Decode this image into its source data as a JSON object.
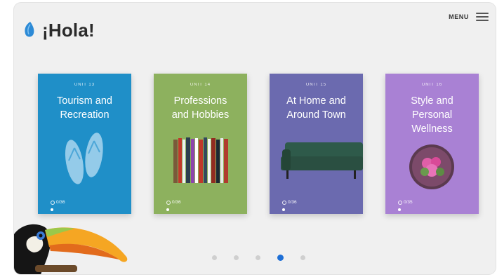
{
  "app": {
    "title": "¡Hola!",
    "menu_label": "MENU"
  },
  "cards": [
    {
      "unit": "UNIT 13",
      "title_line1": "Tourism and",
      "title_line2": "Recreation",
      "title_line3": "",
      "progress": "0/36",
      "color": "#1f8fc8"
    },
    {
      "unit": "UNIT 14",
      "title_line1": "Professions",
      "title_line2": "and Hobbies",
      "title_line3": "",
      "progress": "0/36",
      "color": "#8db15e"
    },
    {
      "unit": "UNIT 15",
      "title_line1": "At Home and",
      "title_line2": "Around Town",
      "title_line3": "",
      "progress": "0/36",
      "color": "#6b6aaf"
    },
    {
      "unit": "UNIT 16",
      "title_line1": "Style and",
      "title_line2": "Personal",
      "title_line3": "Wellness",
      "progress": "0/35",
      "color": "#a981d4"
    }
  ],
  "pager": {
    "count": 5,
    "active_index": 3
  },
  "colors": {
    "accent": "#1e6fd6",
    "logo": "#2c8ad6"
  }
}
